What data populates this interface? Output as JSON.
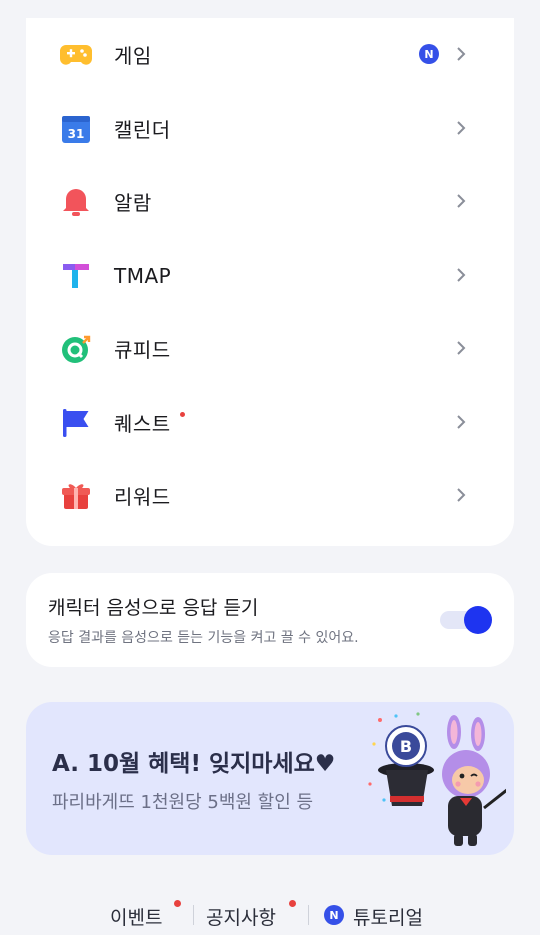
{
  "menu": {
    "items": [
      {
        "label": "게임",
        "icon": "gamepad-icon",
        "badge": "N"
      },
      {
        "label": "캘린더",
        "icon": "calendar-icon",
        "calendar_day": "31"
      },
      {
        "label": "알람",
        "icon": "bell-icon"
      },
      {
        "label": "TMAP",
        "icon": "tmap-icon"
      },
      {
        "label": "큐피드",
        "icon": "qpid-icon"
      },
      {
        "label": "퀘스트",
        "icon": "flag-icon",
        "has_dot": true
      },
      {
        "label": "리워드",
        "icon": "gift-icon"
      }
    ]
  },
  "voice": {
    "title": "캐릭터 음성으로 응답 듣기",
    "description": "응답 결과를 음성으로 듣는 기능을 켜고 끌 수 있어요.",
    "enabled": true
  },
  "banner": {
    "title": "A. 10월 혜택! 잊지마세요♥",
    "subtitle": "파리바게뜨 1천원당 5백원 할인 등",
    "medal_letter": "B"
  },
  "footer": {
    "event_label": "이벤트",
    "notice_label": "공지사항",
    "tutorial_badge": "N",
    "tutorial_label": "튜토리얼"
  },
  "colors": {
    "accent": "#1e34f0",
    "badge": "#3550e8",
    "dot": "#e8413e",
    "banner_bg": "#e2e6fd",
    "page_bg": "#f3f4f8"
  }
}
